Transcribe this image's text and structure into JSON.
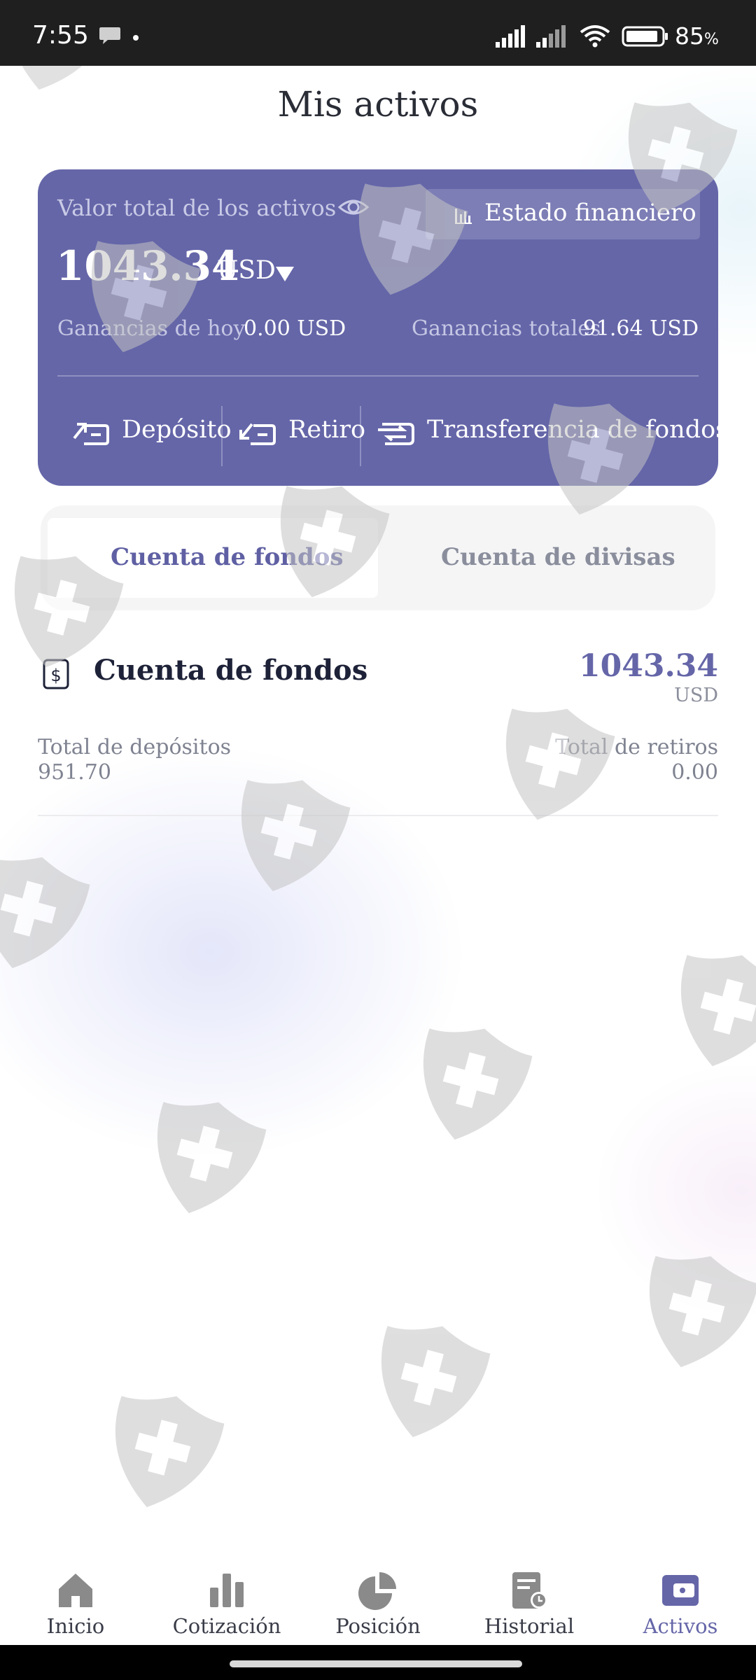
{
  "status_bar": {
    "time": "7:55",
    "battery": "85",
    "battery_unit": "%"
  },
  "header": {
    "title": "Mis activos"
  },
  "summary": {
    "total_label": "Valor total de los activos",
    "total_value": "1043.34",
    "currency": "USD",
    "statement_label": "Estado financiero",
    "today_label": "Ganancias de hoy",
    "today_value": "0.00 USD",
    "total_gain_label": "Ganancias totales",
    "total_gain_value": "91.64 USD",
    "actions": [
      {
        "label": "Depósito",
        "icon": "deposit-icon"
      },
      {
        "label": "Retiro",
        "icon": "withdraw-icon"
      },
      {
        "label": "Transferencia de fondos",
        "icon": "transfer-icon"
      }
    ],
    "card_color": "#6566a8"
  },
  "tabs": [
    {
      "label": "Cuenta de fondos",
      "active": true
    },
    {
      "label": "Cuenta de divisas",
      "active": false
    }
  ],
  "account": {
    "name": "Cuenta de fondos",
    "balance": "1043.34",
    "currency": "USD",
    "deposits_label": "Total de depósitos",
    "deposits_value": "951.70",
    "withdrawals_label": "Total de retiros",
    "withdrawals_value": "0.00"
  },
  "bottom_nav": [
    {
      "label": "Inicio",
      "icon": "home-icon",
      "active": false
    },
    {
      "label": "Cotización",
      "icon": "bar-chart-icon",
      "active": false
    },
    {
      "label": "Posición",
      "icon": "pie-chart-icon",
      "active": false
    },
    {
      "label": "Historial",
      "icon": "history-icon",
      "active": false
    },
    {
      "label": "Activos",
      "icon": "wallet-icon",
      "active": true
    }
  ],
  "colors": {
    "accent": "#6566a8",
    "muted_text": "#7f8391"
  }
}
